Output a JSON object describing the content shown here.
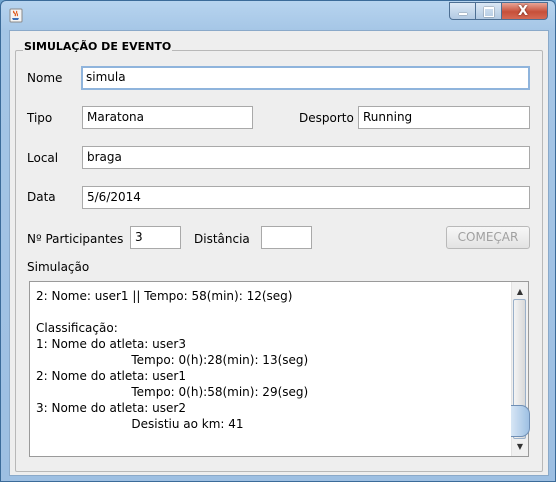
{
  "window": {
    "icon": "java-cup-icon",
    "controls": {
      "minimize": "minimize-icon",
      "maximize": "maximize-icon",
      "close": "close-icon"
    },
    "close_glyph": "X"
  },
  "panel": {
    "title": "SIMULAÇÃO DE EVENTO"
  },
  "form": {
    "nome": {
      "label": "Nome",
      "value": "simula"
    },
    "tipo": {
      "label": "Tipo",
      "value": "Maratona"
    },
    "desporto": {
      "label": "Desporto",
      "value": "Running"
    },
    "local": {
      "label": "Local",
      "value": "braga"
    },
    "data": {
      "label": "Data",
      "value": "5/6/2014"
    },
    "participantes": {
      "label": "Nº Participantes",
      "value": "3"
    },
    "distancia": {
      "label": "Distância",
      "value": ""
    },
    "start_button": "COMEÇAR"
  },
  "simulation": {
    "label": "Simulação",
    "lines": [
      "2: Nome: user1 || Tempo: 58(min): 12(seg)",
      "",
      "Classificação:",
      "1: Nome do atleta: user3",
      "                         Tempo: 0(h):28(min): 13(seg)",
      "2: Nome do atleta: user1",
      "                         Tempo: 0(h):58(min): 29(seg)",
      "3: Nome do atleta: user2",
      "                         Desistiu ao km: 41"
    ]
  },
  "colors": {
    "title_bar": "#a5c6e6",
    "client_bg": "#eeeeee",
    "close_button": "#c7503a",
    "focus_border": "#8fb4dc"
  }
}
